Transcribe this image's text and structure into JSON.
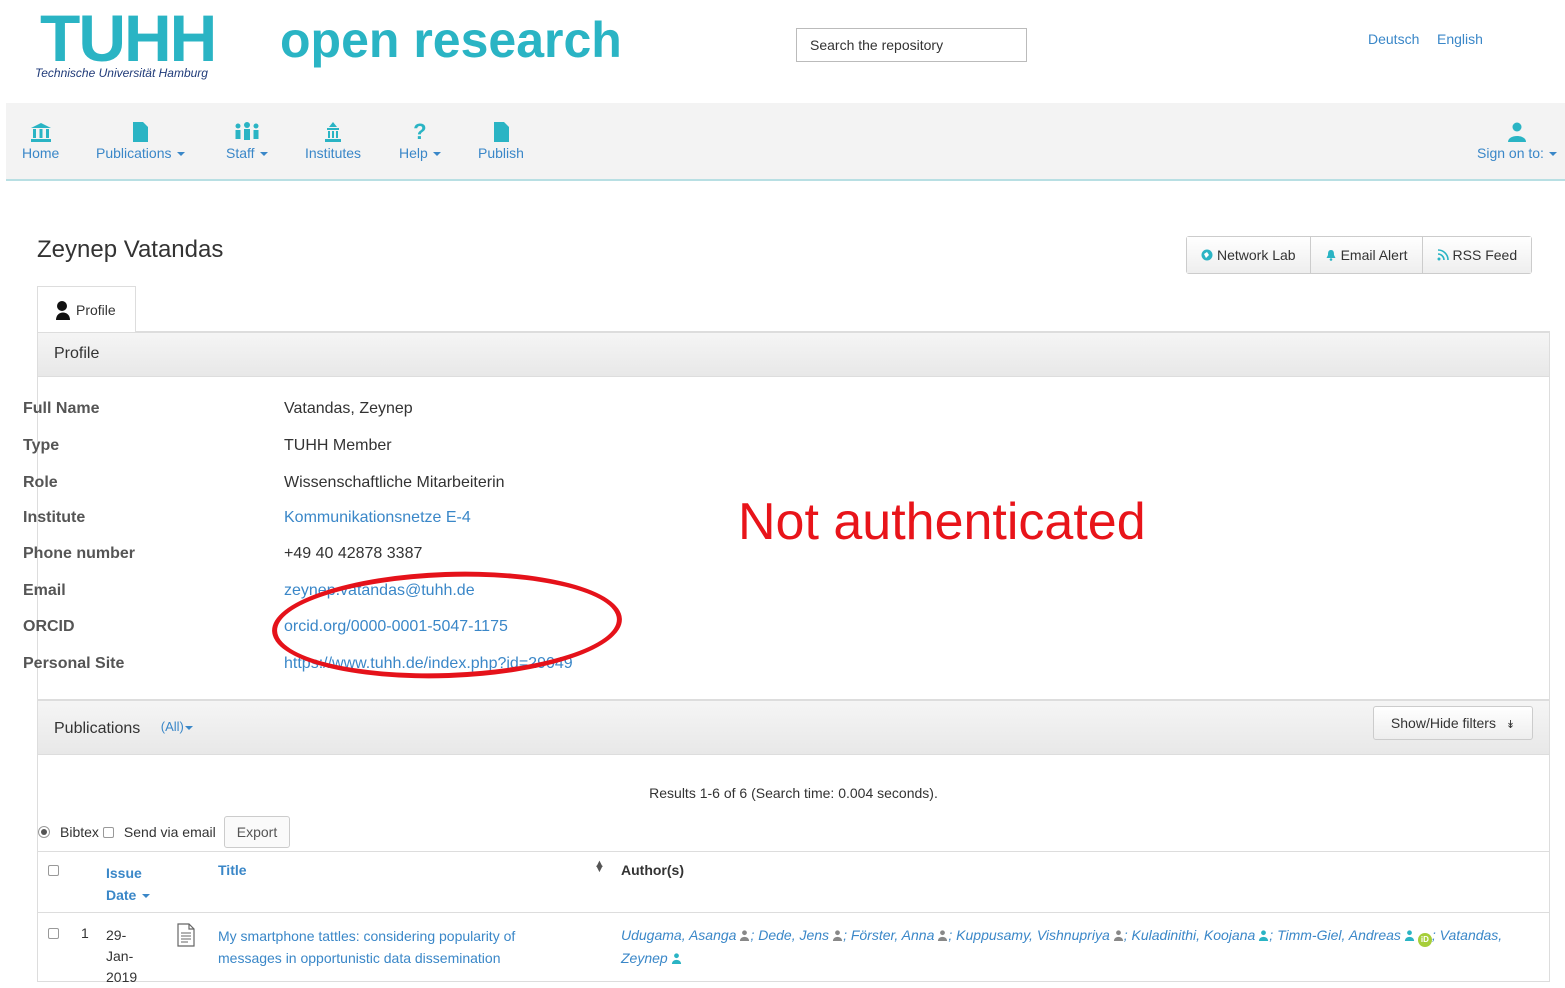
{
  "header": {
    "logo_main": "TUHH",
    "logo_sub": "Technische Universität Hamburg",
    "site_title": "open research",
    "search_placeholder": "Search the repository",
    "lang_de": "Deutsch",
    "lang_en": "English"
  },
  "nav": {
    "home": "Home",
    "publications": "Publications",
    "staff": "Staff",
    "institutes": "Institutes",
    "help": "Help",
    "publish": "Publish",
    "sign_on": "Sign on to:"
  },
  "page": {
    "title": "Zeynep Vatandas",
    "actions": {
      "network_lab": "Network Lab",
      "email_alert": "Email Alert",
      "rss_feed": "RSS Feed"
    },
    "tab_profile": "Profile"
  },
  "profile": {
    "heading": "Profile",
    "fields": {
      "full_name": {
        "label": "Full Name",
        "value": "Vatandas, Zeynep"
      },
      "type": {
        "label": "Type",
        "value": "TUHH Member"
      },
      "role": {
        "label": "Role",
        "value": "Wissenschaftliche Mitarbeiterin"
      },
      "institute": {
        "label": "Institute",
        "value": "Kommunikationsnetze E-4"
      },
      "phone": {
        "label": "Phone number",
        "value": "+49 40 42878 3387"
      },
      "email": {
        "label": "Email",
        "value": "zeynep.vatandas@tuhh.de"
      },
      "orcid": {
        "label": "ORCID",
        "value": "orcid.org/0000-0001-5047-1175"
      },
      "site": {
        "label": "Personal Site",
        "value": "https://www.tuhh.de/index.php?id=29049"
      }
    }
  },
  "annotation": {
    "text": "Not authenticated",
    "color": "#e8141a"
  },
  "publications": {
    "heading": "Publications",
    "filter": "(All)",
    "show_hide": "Show/Hide filters",
    "results": "Results 1-6 of 6 (Search time: 0.004 seconds).",
    "export": {
      "bibtex": "Bibtex",
      "send_email": "Send via email",
      "button": "Export"
    },
    "columns": {
      "issue": "Issue",
      "date": "Date",
      "title": "Title",
      "authors": "Author(s)"
    },
    "rows": [
      {
        "num": "1",
        "date_line1": "29-",
        "date_line2": "Jan-",
        "date_line3": "2019",
        "title_line1": "My smartphone tattles: considering popularity of",
        "title_line2": "messages in opportunistic data dissemination",
        "authors": [
          "Udugama, Asanga",
          "Dede, Jens",
          "Förster, Anna",
          "Kuppusamy, Vishnupriya",
          "Kuladinithi, Koojana",
          "Timm-Giel, Andreas",
          "Vatandas, Zeynep"
        ]
      }
    ]
  },
  "colors": {
    "brand": "#2ab4c4",
    "link": "#3a87c8",
    "nav_bg": "#f3f3f3"
  }
}
